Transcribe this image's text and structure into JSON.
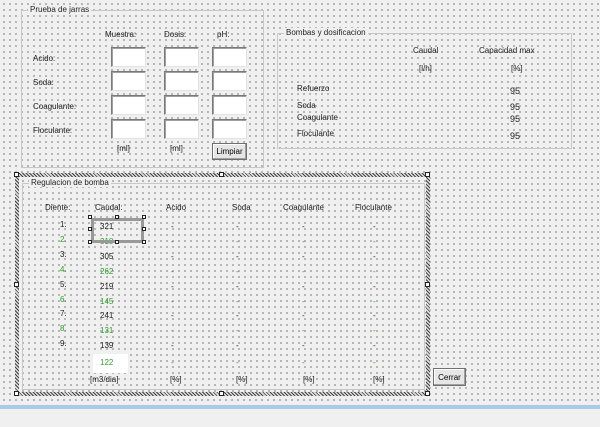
{
  "prueba": {
    "title": "Prueba de jarras",
    "columns": [
      "Muestra:",
      "Dosis:",
      "pH:"
    ],
    "rows": [
      "Acido:",
      "Soda:",
      "Coagulante:",
      "Floculante:"
    ],
    "units": [
      "[ml]",
      "[ml]"
    ],
    "clear_label": "Limpiar"
  },
  "bombas": {
    "title": "Bombas y dosificacion",
    "col_caudal": "Caudal",
    "col_capacidad": "Capacidad max",
    "unit_caudal": "[l/h]",
    "unit_capacidad": "[%]",
    "rows": [
      {
        "label": "Refuerzo",
        "capacidad": "95"
      },
      {
        "label": "Soda",
        "capacidad": "95"
      },
      {
        "label": "Coagulante",
        "capacidad": "95"
      },
      {
        "label": "Floculante",
        "capacidad": "95"
      }
    ]
  },
  "regulacion": {
    "title": "Regulacion de bomba",
    "headers": [
      "Diente:",
      "Caudal:",
      "Acido",
      "Soda",
      "Coagulante",
      "Floculante"
    ],
    "rows": [
      {
        "diente": "1.",
        "caudal": "321",
        "acido": "-",
        "soda": "-",
        "coag": "-",
        "floc": "-",
        "green": false
      },
      {
        "diente": "2.",
        "caudal": "318",
        "acido": "-",
        "soda": "-",
        "coag": "-",
        "floc": "-",
        "green": true
      },
      {
        "diente": "3.",
        "caudal": "305",
        "acido": "-",
        "soda": "-",
        "coag": "-",
        "floc": "-",
        "green": false
      },
      {
        "diente": "4.",
        "caudal": "262",
        "acido": "-",
        "soda": "-",
        "coag": "-",
        "floc": "-",
        "green": true
      },
      {
        "diente": "5.",
        "caudal": "219",
        "acido": "-",
        "soda": "-",
        "coag": "-",
        "floc": "-",
        "green": false
      },
      {
        "diente": "6.",
        "caudal": "145",
        "acido": "-",
        "soda": "-",
        "coag": "-",
        "floc": "-",
        "green": true
      },
      {
        "diente": "7.",
        "caudal": "241",
        "acido": "-",
        "soda": "-",
        "coag": "-",
        "floc": "-",
        "green": false
      },
      {
        "diente": "8.",
        "caudal": "131",
        "acido": "-",
        "soda": "-",
        "coag": "-",
        "floc": "-",
        "green": true
      },
      {
        "diente": "9.",
        "caudal": "139",
        "acido": "-",
        "soda": "-",
        "coag": "-",
        "floc": "-",
        "green": false
      },
      {
        "diente": "",
        "caudal": "122",
        "acido": "-",
        "soda": "-",
        "coag": "-",
        "floc": "-",
        "green": true
      }
    ],
    "units": [
      "[m3/dia]",
      "[%]",
      "[%]",
      "[%]",
      "[%]"
    ]
  },
  "close_label": "Cerrar",
  "colors": {
    "green": "#2e9e2e",
    "taskbar": "#a9cbe8"
  }
}
